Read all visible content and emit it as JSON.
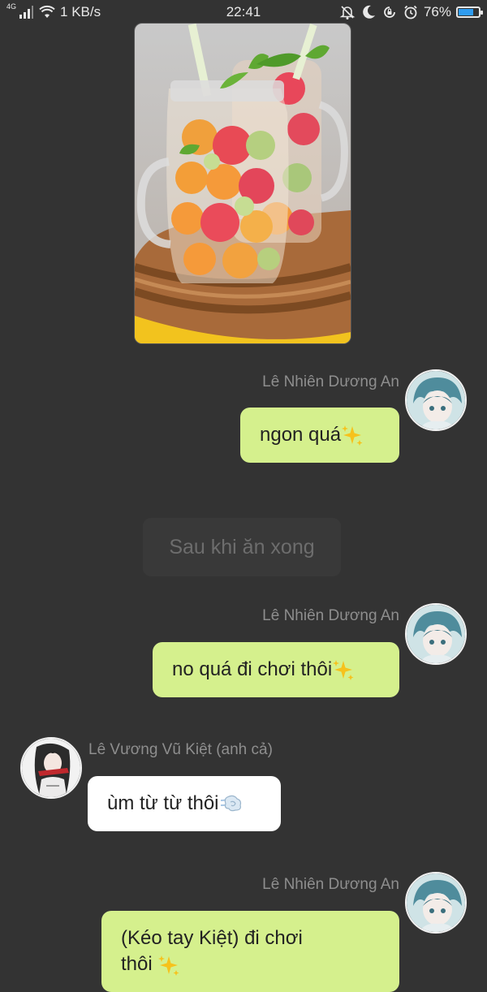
{
  "status_bar": {
    "network": "4G",
    "speed": "1 KB/s",
    "time": "22:41",
    "battery": "76%",
    "battery_level": 0.76,
    "icons": [
      "signal-icon",
      "wifi-icon",
      "bell-off-icon",
      "moon-icon",
      "rotation-lock-icon",
      "alarm-icon",
      "battery-icon"
    ]
  },
  "photo": {
    "icon": "melon-drink-photo"
  },
  "messages": [
    {
      "sender": "Lê Nhiên Dương An",
      "text": "ngon quá",
      "emoji": "sparkles-icon"
    },
    {
      "narration": "Sau khi ăn xong"
    },
    {
      "sender": "Lê Nhiên Dương An",
      "text": "no quá đi chơi thôi",
      "emoji": "sparkles-icon"
    },
    {
      "sender": "Lê Vương Vũ Kiệt (anh cả)",
      "text": "ùm từ từ thôi",
      "emoji": "dash-icon"
    },
    {
      "sender": "Lê Nhiên Dương An",
      "text_line1": "(Kéo tay Kiệt) đi chơi",
      "text_line2": "thôi",
      "emoji": "sparkles-icon"
    }
  ],
  "colors": {
    "background": "#333333",
    "bubble_green": "#d5f08d",
    "bubble_white": "#ffffff",
    "sender_name": "#8e8e8e",
    "narration_bg": "#393939"
  }
}
